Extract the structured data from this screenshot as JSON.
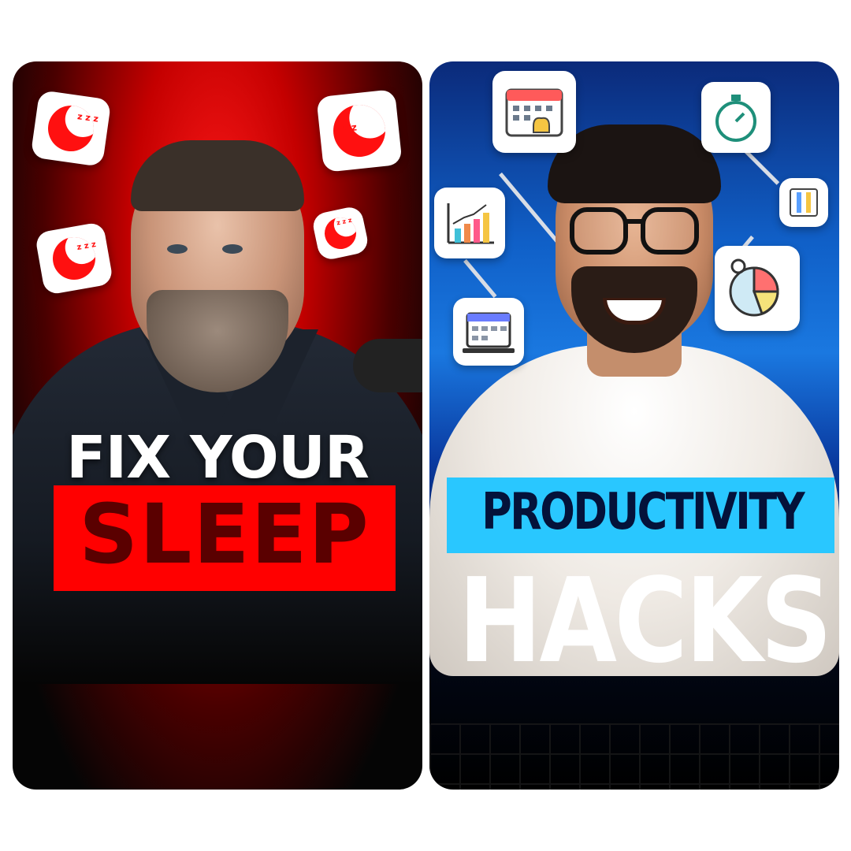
{
  "left_card": {
    "headline_line1": "FIX YOUR",
    "headline_line2": "SLEEP",
    "accent_color": "#ff0000",
    "icons": [
      "moon-sleep-icon",
      "moon-sleep-icon",
      "moon-sleep-icon",
      "moon-sleep-icon"
    ],
    "zz": "z z z"
  },
  "right_card": {
    "headline_line1": "PRODUCTIVITY",
    "headline_line2": "HACKS",
    "accent_color": "#29c7ff",
    "icons": [
      "calendar-bell-icon",
      "stopwatch-icon",
      "bar-chart-icon",
      "ruler-pencil-icon",
      "calendar-laptop-icon",
      "pie-chart-icon"
    ]
  }
}
